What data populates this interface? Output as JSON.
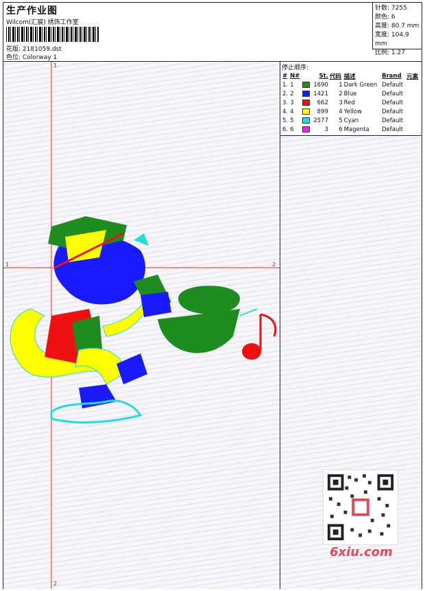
{
  "header": {
    "title": "生产作业图",
    "studio": "Wilcom(汇宸) 绣饰工作室",
    "design_file": "花版: 2181059.dst",
    "colorway": "色位: Colorway 1"
  },
  "specs": [
    "针数: 7255",
    "颜色: 6",
    "高度: 80.7 mm",
    "宽度: 104.9 mm",
    "比例: 1.27"
  ],
  "stop_sequence": {
    "title": "停止顺序:",
    "headers": [
      "#",
      "N#",
      "St.",
      "代码",
      "描述",
      "Brand",
      "元素"
    ],
    "rows": [
      {
        "idx": "1.",
        "n": "1",
        "color": "#1e8c1e",
        "st": "1690",
        "code": "1",
        "desc": "Dark Green",
        "brand": "Default"
      },
      {
        "idx": "2.",
        "n": "2",
        "color": "#1a1aff",
        "st": "1421",
        "code": "2",
        "desc": "Blue",
        "brand": "Default"
      },
      {
        "idx": "3.",
        "n": "3",
        "color": "#ee1111",
        "st": "662",
        "code": "3",
        "desc": "Red",
        "brand": "Default"
      },
      {
        "idx": "4.",
        "n": "4",
        "color": "#ffff00",
        "st": "899",
        "code": "4",
        "desc": "Yellow",
        "brand": "Default"
      },
      {
        "idx": "5.",
        "n": "5",
        "color": "#22dddd",
        "st": "2577",
        "code": "5",
        "desc": "Cyan",
        "brand": "Default"
      },
      {
        "idx": "6.",
        "n": "6",
        "color": "#ee22ee",
        "st": "3",
        "code": "6",
        "desc": "Magenta",
        "brand": "Default"
      }
    ]
  },
  "axes": {
    "v_top": "1",
    "v_bottom": "2",
    "h_left": "1",
    "h_right": "2"
  },
  "watermark": "6xiu.com",
  "colors": {
    "guide_line": "#ff2222"
  }
}
